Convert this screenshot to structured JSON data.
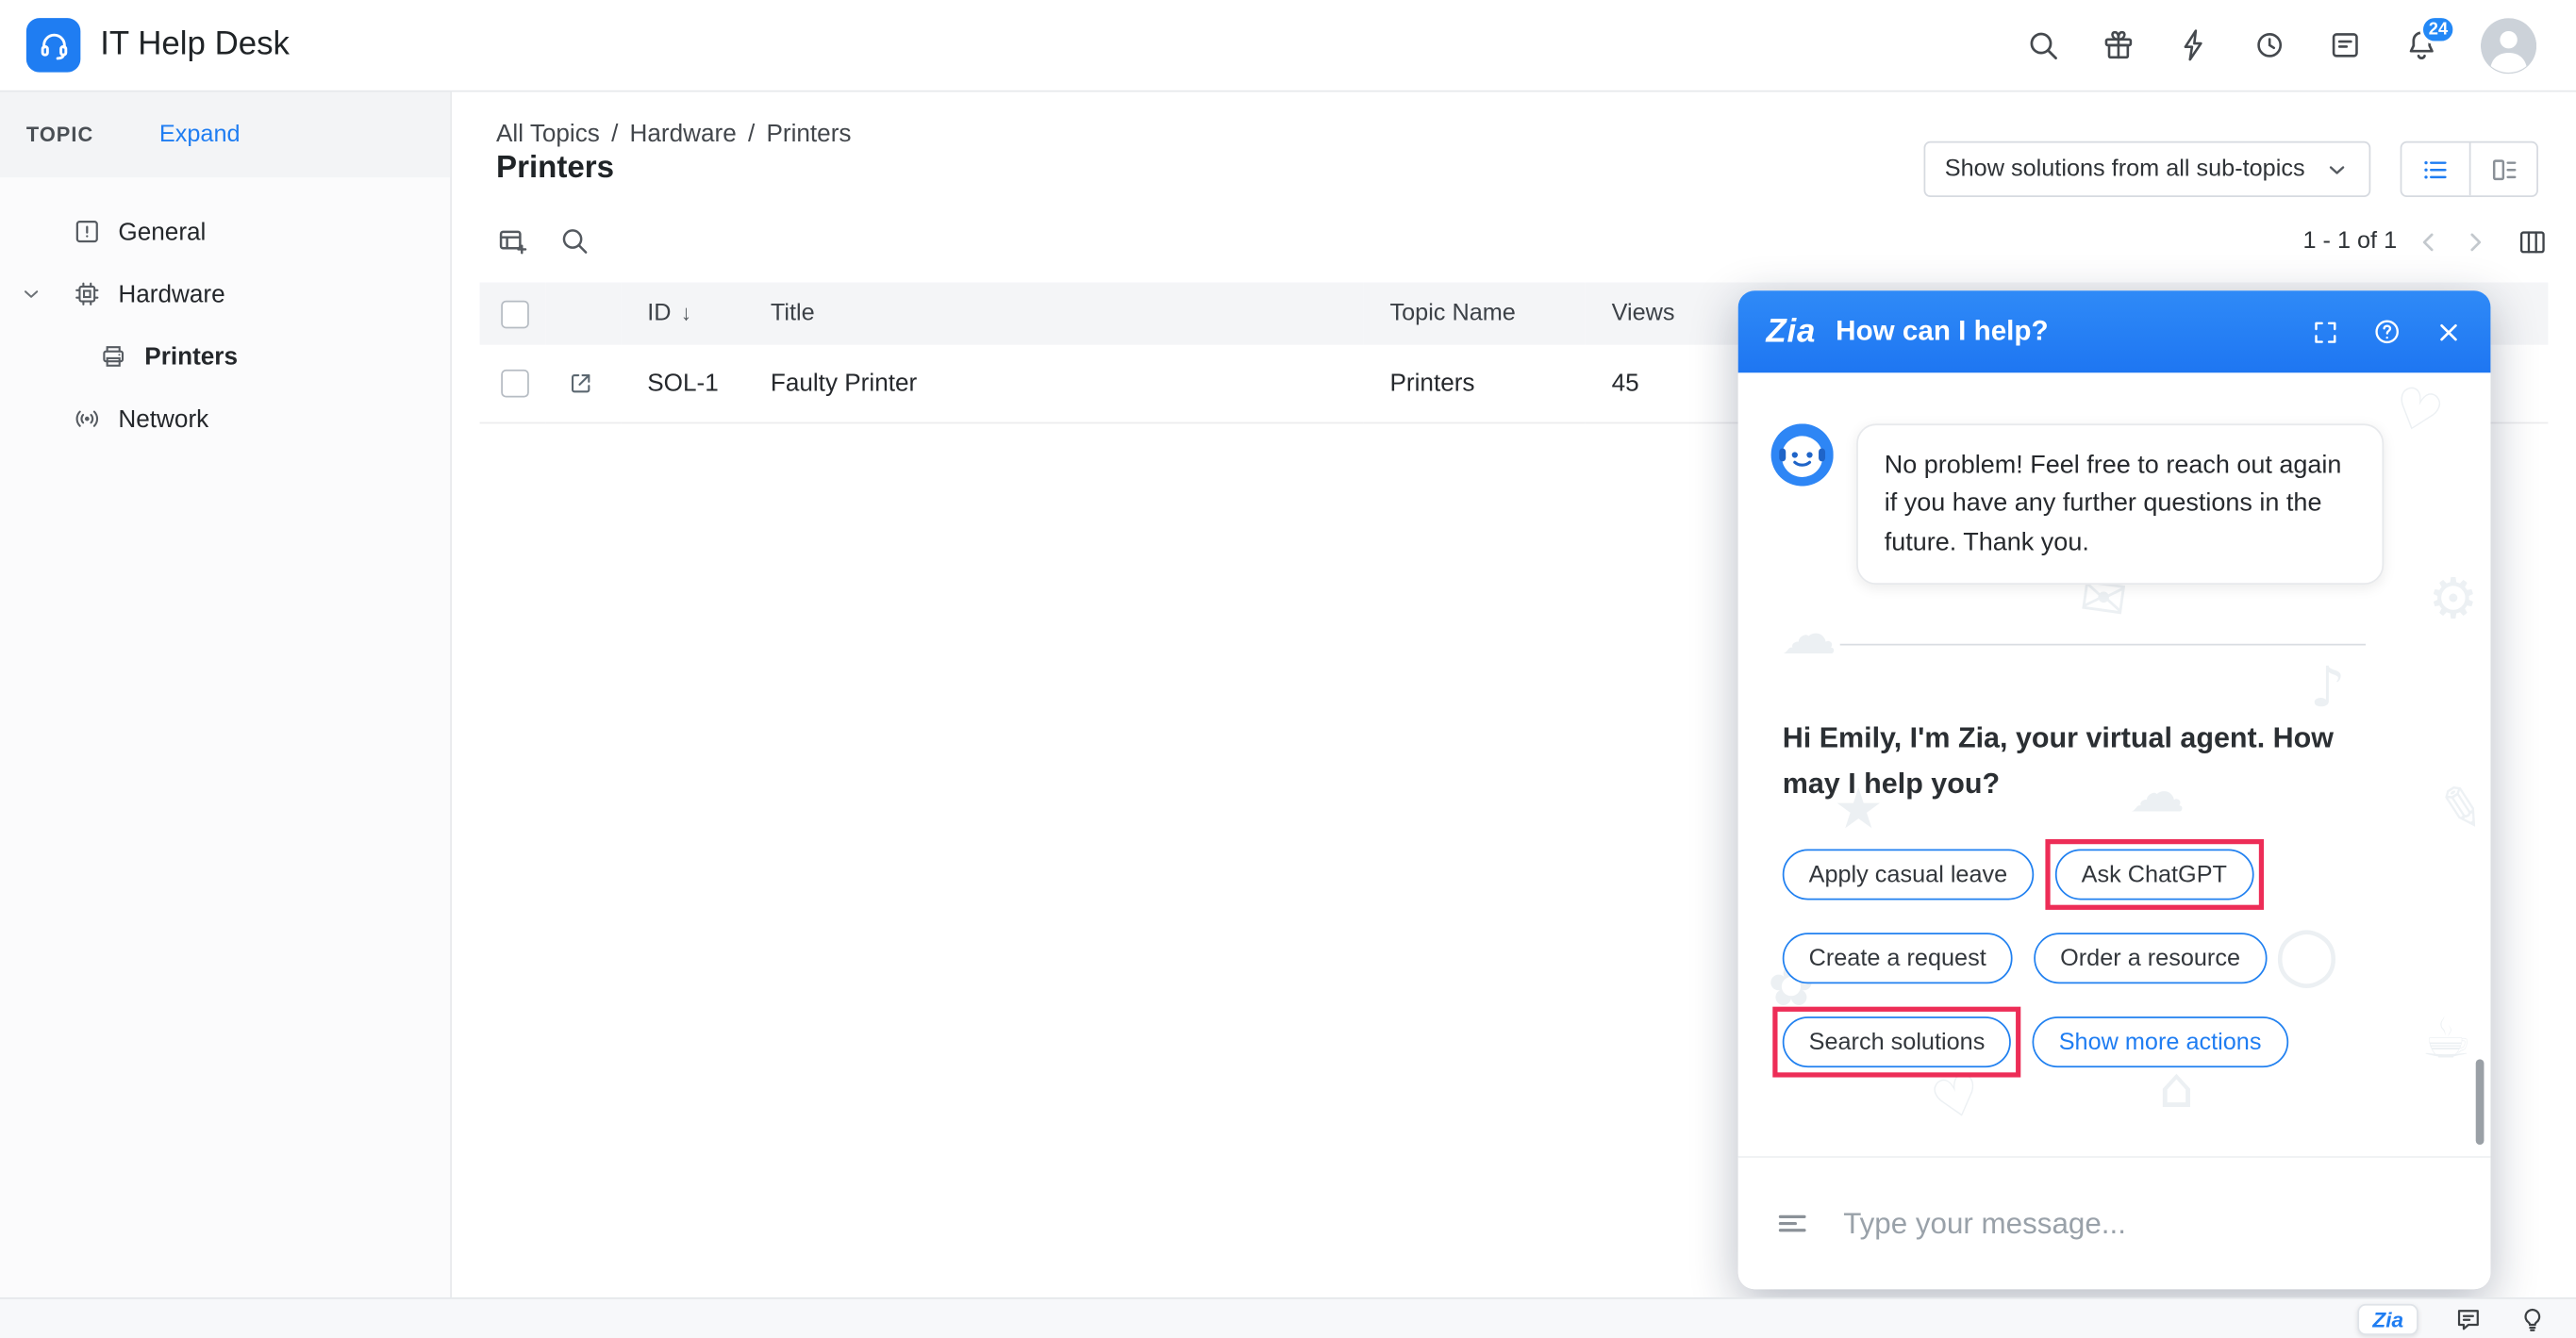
{
  "app": {
    "title": "IT Help Desk"
  },
  "topbar": {
    "notification_count": "24"
  },
  "icons": {
    "zia_logo_text": "Zia",
    "sort_desc": "↓"
  },
  "sidebar": {
    "header_label": "TOPIC",
    "expand_label": "Expand",
    "items": [
      {
        "label": "General"
      },
      {
        "label": "Hardware"
      },
      {
        "label": "Printers"
      },
      {
        "label": "Network"
      }
    ]
  },
  "main": {
    "breadcrumb": {
      "parts": [
        "All Topics",
        "Hardware",
        "Printers"
      ],
      "separator": "/"
    },
    "page_title": "Printers",
    "filter_dropdown_value": "Show solutions from all sub-topics",
    "pagination_text": "1 - 1 of 1",
    "table": {
      "headers": {
        "id": "ID",
        "title": "Title",
        "topic": "Topic Name",
        "views": "Views"
      },
      "rows": [
        {
          "id": "SOL-1",
          "title": "Faulty Printer",
          "topic": "Printers",
          "views": "45"
        }
      ]
    }
  },
  "chat": {
    "title": "How can I help?",
    "bot_message": "No problem! Feel free to reach out again if you have any further questions in the future. Thank you.",
    "greeting": "Hi Emily, I'm Zia, your virtual agent. How may I help you?",
    "actions": [
      {
        "label": "Apply casual leave",
        "highlighted": false,
        "style": "normal"
      },
      {
        "label": "Ask ChatGPT",
        "highlighted": true,
        "style": "normal"
      },
      {
        "label": "Create a request",
        "highlighted": false,
        "style": "normal"
      },
      {
        "label": "Order a resource",
        "highlighted": false,
        "style": "normal"
      },
      {
        "label": "Search solutions",
        "highlighted": true,
        "style": "normal"
      },
      {
        "label": "Show more actions",
        "highlighted": false,
        "style": "link"
      }
    ],
    "input_placeholder": "Type your message..."
  },
  "colors": {
    "accent": "#1f7df2",
    "annotation_highlight": "#ed2d57",
    "badge": "#2388f6"
  }
}
